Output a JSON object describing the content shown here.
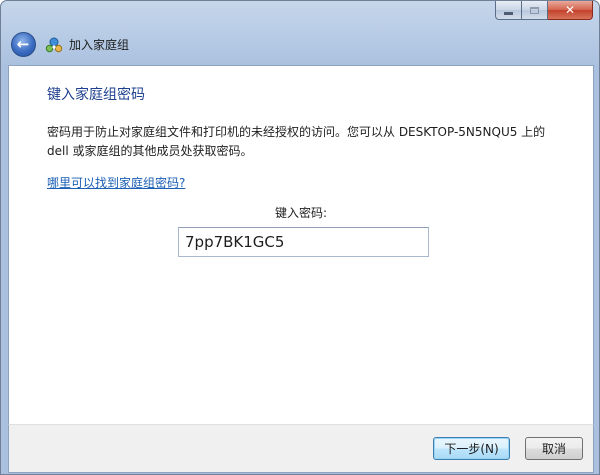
{
  "window": {
    "title": "加入家庭组",
    "caption_buttons": {
      "minimize": "minimize-icon",
      "maximize": "maximize-icon",
      "close": "✕"
    }
  },
  "content": {
    "heading": "键入家庭组密码",
    "description": "密码用于防止对家庭组文件和打印机的未经授权的访问。您可以从 DESKTOP-5N5NQU5 上的 dell 或家庭组的其他成员处获取密码。",
    "help_link": "哪里可以找到家庭组密码?",
    "password_label": "键入密码:",
    "password_value": "7pp7BK1GC5"
  },
  "buttons": {
    "next": "下一步(N)",
    "cancel": "取消"
  },
  "icons": {
    "back": "back-arrow-icon",
    "homegroup": "homegroup-icon"
  },
  "colors": {
    "heading": "#1d3f8f",
    "link": "#1a5fb4",
    "close_button": "#c2412a"
  }
}
